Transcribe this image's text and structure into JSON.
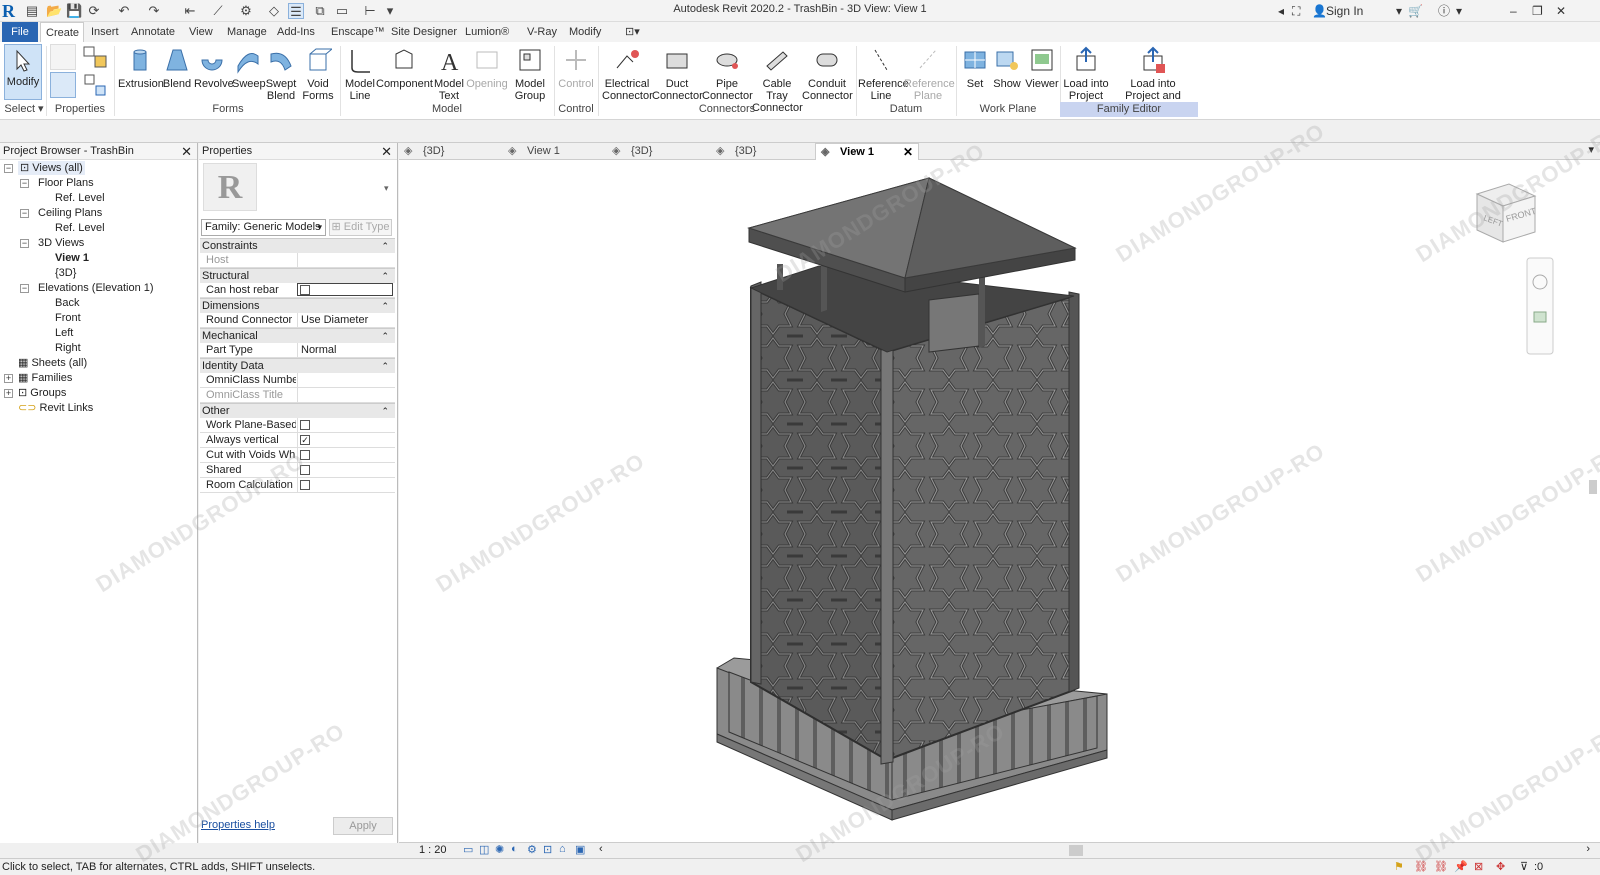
{
  "titlebar": {
    "title": "Autodesk Revit 2020.2 - TrashBin - 3D View: View 1",
    "sign_in": "Sign In"
  },
  "menu": {
    "tabs": [
      "File",
      "Create",
      "Insert",
      "Annotate",
      "View",
      "Manage",
      "Add-Ins",
      "Enscape™",
      "Site Designer",
      "Lumion®",
      "V-Ray",
      "Modify"
    ],
    "active": "Create"
  },
  "ribbon": {
    "select": {
      "modify": "Modify",
      "panel": "Select"
    },
    "properties_panel": "Properties",
    "forms": {
      "items": [
        "Extrusion",
        "Blend",
        "Revolve",
        "Sweep",
        "Swept\nBlend",
        "Void\nForms"
      ],
      "panel": "Forms"
    },
    "model": {
      "items": [
        "Model\nLine",
        "Component",
        "Model\nText",
        "Opening",
        "Model\nGroup"
      ],
      "panel": "Model"
    },
    "control": {
      "items": [
        "Control"
      ],
      "panel": "Control"
    },
    "connectors": {
      "items": [
        "Electrical\nConnector",
        "Duct\nConnector",
        "Pipe\nConnector",
        "Cable Tray\nConnector",
        "Conduit\nConnector"
      ],
      "panel": "Connectors"
    },
    "datum": {
      "items": [
        "Reference\nLine",
        "Reference\nPlane"
      ],
      "panel": "Datum"
    },
    "work_plane": {
      "items": [
        "Set",
        "Show",
        "Viewer"
      ],
      "panel": "Work Plane"
    },
    "family_editor": {
      "items": [
        "Load into\nProject",
        "Load into\nProject and Close"
      ],
      "panel": "Family Editor"
    }
  },
  "project_browser": {
    "title": "Project Browser - TrashBin",
    "items": [
      "Views (all)",
      "Floor Plans",
      "Ref. Level",
      "Ceiling Plans",
      "Ref. Level",
      "3D Views",
      "View 1",
      "{3D}",
      "Elevations (Elevation 1)",
      "Back",
      "Front",
      "Left",
      "Right",
      "Sheets (all)",
      "Families",
      "Groups",
      "Revit Links"
    ]
  },
  "properties": {
    "title": "Properties",
    "family": "Family: Generic Models",
    "edit_type": "Edit Type",
    "groups": {
      "constraints": "Constraints",
      "structural": "Structural",
      "dimensions": "Dimensions",
      "mechanical": "Mechanical",
      "identity": "Identity Data",
      "other": "Other"
    },
    "rows": {
      "host": "Host",
      "can_host_rebar": "Can host rebar",
      "round_connector": "Round Connector ...",
      "round_connector_val": "Use Diameter",
      "part_type": "Part Type",
      "part_type_val": "Normal",
      "omniclass_number": "OmniClass Number",
      "omniclass_title": "OmniClass Title",
      "work_plane_based": "Work Plane-Based",
      "always_vertical": "Always vertical",
      "cut_with_voids": "Cut with Voids Wh...",
      "shared": "Shared",
      "room_calc": "Room Calculation ..."
    },
    "help": "Properties help",
    "apply": "Apply"
  },
  "view_tabs": [
    "{3D}",
    "View 1",
    "{3D}",
    "{3D}",
    "View 1"
  ],
  "view": {
    "scale": "1 : 20",
    "viewcube_left": "LEFT",
    "viewcube_front": "FRONT"
  },
  "status": {
    "text": "Click to select, TAB for alternates, CTRL adds, SHIFT unselects.",
    "filter_count": ":0"
  },
  "watermark": "DIAMONDGROUP-RO",
  "colors": {
    "accent": "#2a66b3",
    "family_editor_panel": "#c9d4f0",
    "model": "#565656"
  }
}
